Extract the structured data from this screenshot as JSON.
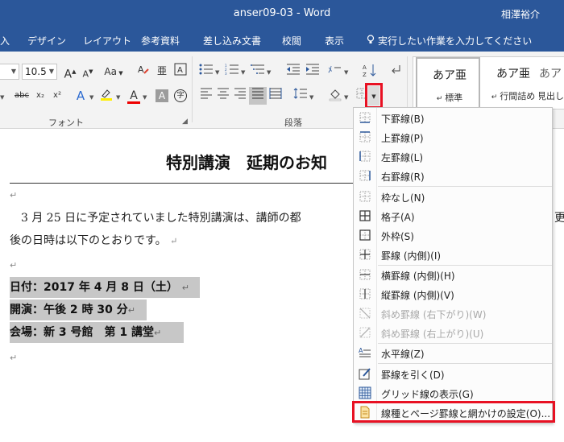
{
  "window": {
    "doc_title": "anser09-03 - Word",
    "user": "相澤裕介"
  },
  "tabs": [
    {
      "label": "入"
    },
    {
      "label": "デザイン"
    },
    {
      "label": "レイアウト"
    },
    {
      "label": "参考資料"
    },
    {
      "label": "差し込み文書"
    },
    {
      "label": "校閲"
    },
    {
      "label": "表示"
    }
  ],
  "tell_me": "実行したい作業を入力してください",
  "ribbon": {
    "font_size": "10.5",
    "font_group_label": "フォント",
    "paragraph_group_label": "段落",
    "font_buttons": {
      "grow": "A",
      "shrink": "A",
      "case": "Aa",
      "strike": "abc",
      "subscript": "x₂",
      "superscript": "x²",
      "color_letter": "A",
      "shade_letter": "A",
      "enclose": "字"
    },
    "styles": [
      {
        "preview": "あア亜",
        "name": "標準"
      },
      {
        "preview": "あア亜",
        "name": "行間詰め"
      },
      {
        "preview": "あア",
        "name": "見出し"
      }
    ]
  },
  "document": {
    "title": "特別講演　延期のお知",
    "body_line1": "3 月 25 日に予定されていました特別講演は、講師の都",
    "body_line1_tail": "更",
    "body_line2": "後の日時は以下のとおりです。",
    "lines": [
      "日付：2017 年 4 月 8 日（土）",
      "開演：午後 2 時 30 分",
      "会場：新 3 号館　第 1 講堂"
    ],
    "mark": "↵"
  },
  "border_menu": {
    "items": [
      {
        "label": "下罫線(B)",
        "icon": "border-bottom-icon",
        "disabled": false
      },
      {
        "label": "上罫線(P)",
        "icon": "border-top-icon",
        "disabled": false
      },
      {
        "label": "左罫線(L)",
        "icon": "border-left-icon",
        "disabled": false
      },
      {
        "label": "右罫線(R)",
        "icon": "border-right-icon",
        "disabled": false
      },
      {
        "label": "枠なし(N)",
        "icon": "no-border-icon",
        "disabled": false
      },
      {
        "label": "格子(A)",
        "icon": "all-borders-icon",
        "disabled": false
      },
      {
        "label": "外枠(S)",
        "icon": "outside-borders-icon",
        "disabled": false
      },
      {
        "label": "罫線 (内側)(I)",
        "icon": "inside-borders-icon",
        "disabled": false
      },
      {
        "label": "横罫線 (内側)(H)",
        "icon": "inside-horizontal-icon",
        "disabled": false
      },
      {
        "label": "縦罫線 (内側)(V)",
        "icon": "inside-vertical-icon",
        "disabled": false
      },
      {
        "label": "斜め罫線 (右下がり)(W)",
        "icon": "diagonal-down-icon",
        "disabled": true
      },
      {
        "label": "斜め罫線 (右上がり)(U)",
        "icon": "diagonal-up-icon",
        "disabled": true
      },
      {
        "label": "水平線(Z)",
        "icon": "horizontal-line-icon",
        "disabled": false
      },
      {
        "label": "罫線を引く(D)",
        "icon": "draw-table-icon",
        "disabled": false
      },
      {
        "label": "グリッド線の表示(G)",
        "icon": "view-gridlines-icon",
        "disabled": false
      },
      {
        "label": "線種とページ罫線と網かけの設定(O)...",
        "icon": "borders-shading-icon",
        "disabled": false
      }
    ]
  },
  "colors": {
    "word_blue": "#2b579a",
    "highlight_red": "#e81123",
    "text_highlight_gray": "#c7c7c7"
  }
}
